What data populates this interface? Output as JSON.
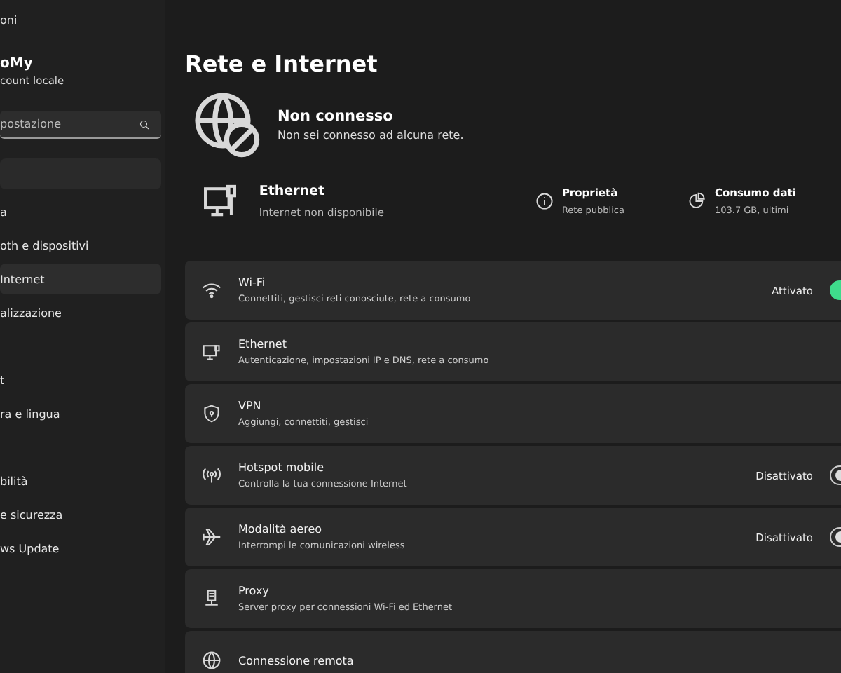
{
  "window": {
    "title": "oni"
  },
  "account": {
    "name": "oMy",
    "type": "count locale"
  },
  "search": {
    "placeholder": "postazione"
  },
  "sidebar": {
    "items": [
      {
        "label": "a",
        "selected": false
      },
      {
        "label": "oth e dispositivi",
        "selected": false
      },
      {
        "label": "Internet",
        "selected": true
      },
      {
        "label": "alizzazione",
        "selected": false
      },
      {
        "label": "t",
        "selected": false
      },
      {
        "label": "ra e lingua",
        "selected": false
      },
      {
        "label": "bilità",
        "selected": false
      },
      {
        "label": "e sicurezza",
        "selected": false
      },
      {
        "label": "ws Update",
        "selected": false
      }
    ]
  },
  "page_title": "Rete e Internet",
  "status": {
    "title": "Non connesso",
    "subtitle": "Non sei connesso ad alcuna rete."
  },
  "connection": {
    "name": "Ethernet",
    "detail": "Internet non disponibile",
    "properties": {
      "title": "Proprietà",
      "value": "Rete pubblica"
    },
    "data_usage": {
      "title": "Consumo dati",
      "value": "103.7 GB, ultimi"
    }
  },
  "settings": [
    {
      "kind": "toggle",
      "title": "Wi-Fi",
      "subtitle": "Connettiti, gestisci reti conosciute, rete a consumo",
      "state": "Attivato",
      "on": true
    },
    {
      "kind": "link",
      "title": "Ethernet",
      "subtitle": "Autenticazione, impostazioni IP e DNS, rete a consumo"
    },
    {
      "kind": "link",
      "title": "VPN",
      "subtitle": "Aggiungi, connettiti, gestisci"
    },
    {
      "kind": "toggle",
      "title": "Hotspot mobile",
      "subtitle": "Controlla la tua connessione Internet",
      "state": "Disattivato",
      "on": false
    },
    {
      "kind": "toggle",
      "title": "Modalità aereo",
      "subtitle": "Interrompi le comunicazioni wireless",
      "state": "Disattivato",
      "on": false
    },
    {
      "kind": "link",
      "title": "Proxy",
      "subtitle": "Server proxy per connessioni Wi-Fi ed Ethernet"
    },
    {
      "kind": "link",
      "title": "Connessione remota"
    }
  ]
}
